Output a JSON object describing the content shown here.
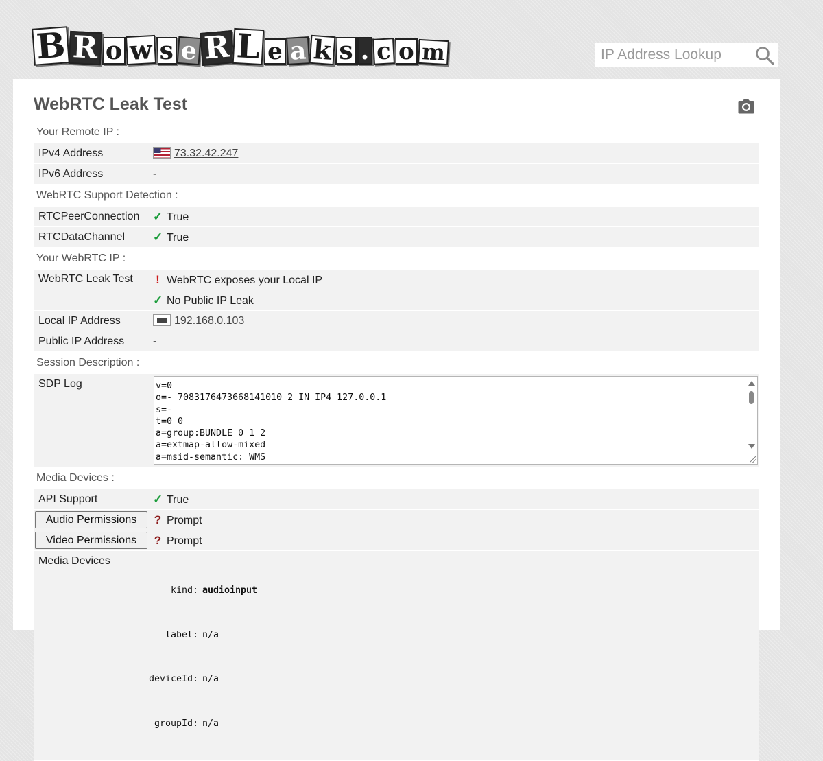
{
  "logo": {
    "text": "BrowserLeaks.com",
    "tiles": [
      "B",
      "R",
      "o",
      "w",
      "s",
      "e",
      "R",
      "L",
      "e",
      "a",
      "k",
      "s",
      ".",
      "c",
      "o",
      "m"
    ]
  },
  "search": {
    "placeholder": "IP Address Lookup",
    "icon": "search-icon"
  },
  "page": {
    "title": "WebRTC Leak Test",
    "camera_icon": "camera-icon"
  },
  "remote_ip": {
    "section": "Your Remote IP :",
    "ipv4_label": "IPv4 Address",
    "ipv4_value": "73.32.42.247",
    "ipv4_flag": "us-flag-icon",
    "ipv6_label": "IPv6 Address",
    "ipv6_value": "-"
  },
  "support": {
    "section": "WebRTC Support Detection :",
    "peer_label": "RTCPeerConnection",
    "peer_value": "True",
    "channel_label": "RTCDataChannel",
    "channel_value": "True"
  },
  "webrtc_ip": {
    "section": "Your WebRTC IP :",
    "leak_label": "WebRTC Leak Test",
    "leak_local": "WebRTC exposes your Local IP",
    "leak_public": "No Public IP Leak",
    "local_label": "Local IP Address",
    "local_value": "192.168.0.103",
    "public_label": "Public IP Address",
    "public_value": "-"
  },
  "session": {
    "section": "Session Description :",
    "sdp_label": "SDP Log",
    "sdp_log": "v=0\no=- 7083176473668141010 2 IN IP4 127.0.0.1\ns=-\nt=0 0\na=group:BUNDLE 0 1 2\na=extmap-allow-mixed\na=msid-semantic: WMS"
  },
  "media": {
    "section": "Media Devices :",
    "api_label": "API Support",
    "api_value": "True",
    "audio_button": "Audio Permissions",
    "audio_value": "Prompt",
    "video_button": "Video Permissions",
    "video_value": "Prompt",
    "devices_label": "Media Devices",
    "kind_key": "kind:",
    "kind_value": "audioinput",
    "label_key": "label:",
    "label_value": "n/a",
    "deviceid_key": "deviceId:",
    "deviceid_value": "n/a",
    "groupid_key": "groupId:",
    "groupid_value": "n/a"
  },
  "colors": {
    "check": "#1a9c3a",
    "warning": "#cc1b1b",
    "row_bg": "#f2f2f2",
    "title": "#555555"
  }
}
